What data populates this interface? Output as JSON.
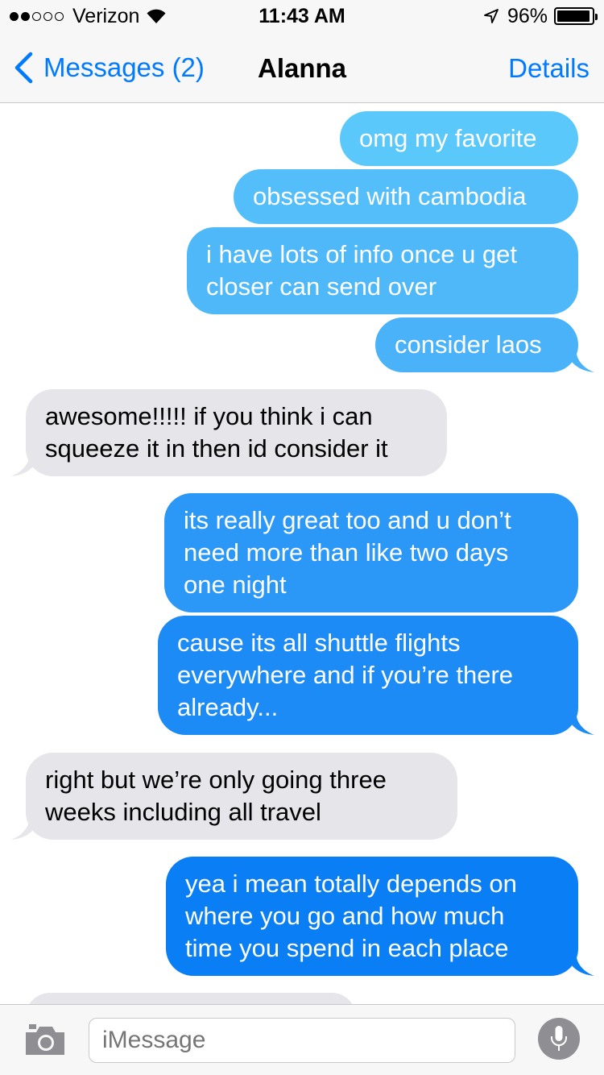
{
  "status_bar": {
    "signal_dots_filled": 2,
    "signal_dots_total": 5,
    "carrier": "Verizon",
    "time": "11:43 AM",
    "battery_percent": "96%",
    "battery_level": 0.96
  },
  "nav": {
    "back_label": "Messages (2)",
    "title": "Alanna",
    "details_label": "Details"
  },
  "messages": [
    {
      "from": "me",
      "text": "omg my favorite",
      "color": "#5ac8fa"
    },
    {
      "from": "me",
      "text": "obsessed with cambodia",
      "color": "#54befa"
    },
    {
      "from": "me",
      "text": "i have lots of info once u get\ncloser can send over",
      "color": "#4fb8f9"
    },
    {
      "from": "me",
      "text": "consider laos",
      "color": "#4ab2f8"
    },
    {
      "from": "them",
      "text": "awesome!!!!! if you think i can\nsqueeze it in then id consider it"
    },
    {
      "from": "me",
      "text": "its really great too and u don’t\nneed more than like two days\none night",
      "color": "#2b97f7"
    },
    {
      "from": "me",
      "text": "cause its all shuttle flights\neverywhere and if you’re there\nalready...",
      "color": "#1c8bf6"
    },
    {
      "from": "them",
      "text": "right but we’re only going three\nweeks including all travel"
    },
    {
      "from": "me",
      "text": "yea i mean totally depends on\nwhere you go and how much\ntime you spend in each place",
      "color": "#0a7ef5"
    }
  ],
  "colors": {
    "accent": "#007aff",
    "incoming_bubble": "#e5e5ea",
    "bar_background": "#f7f7f7"
  },
  "input": {
    "placeholder": "iMessage"
  },
  "icons": {
    "camera": "camera-icon",
    "microphone": "microphone-icon",
    "back": "chevron-left-icon",
    "wifi": "wifi-icon",
    "location": "location-arrow-icon"
  }
}
